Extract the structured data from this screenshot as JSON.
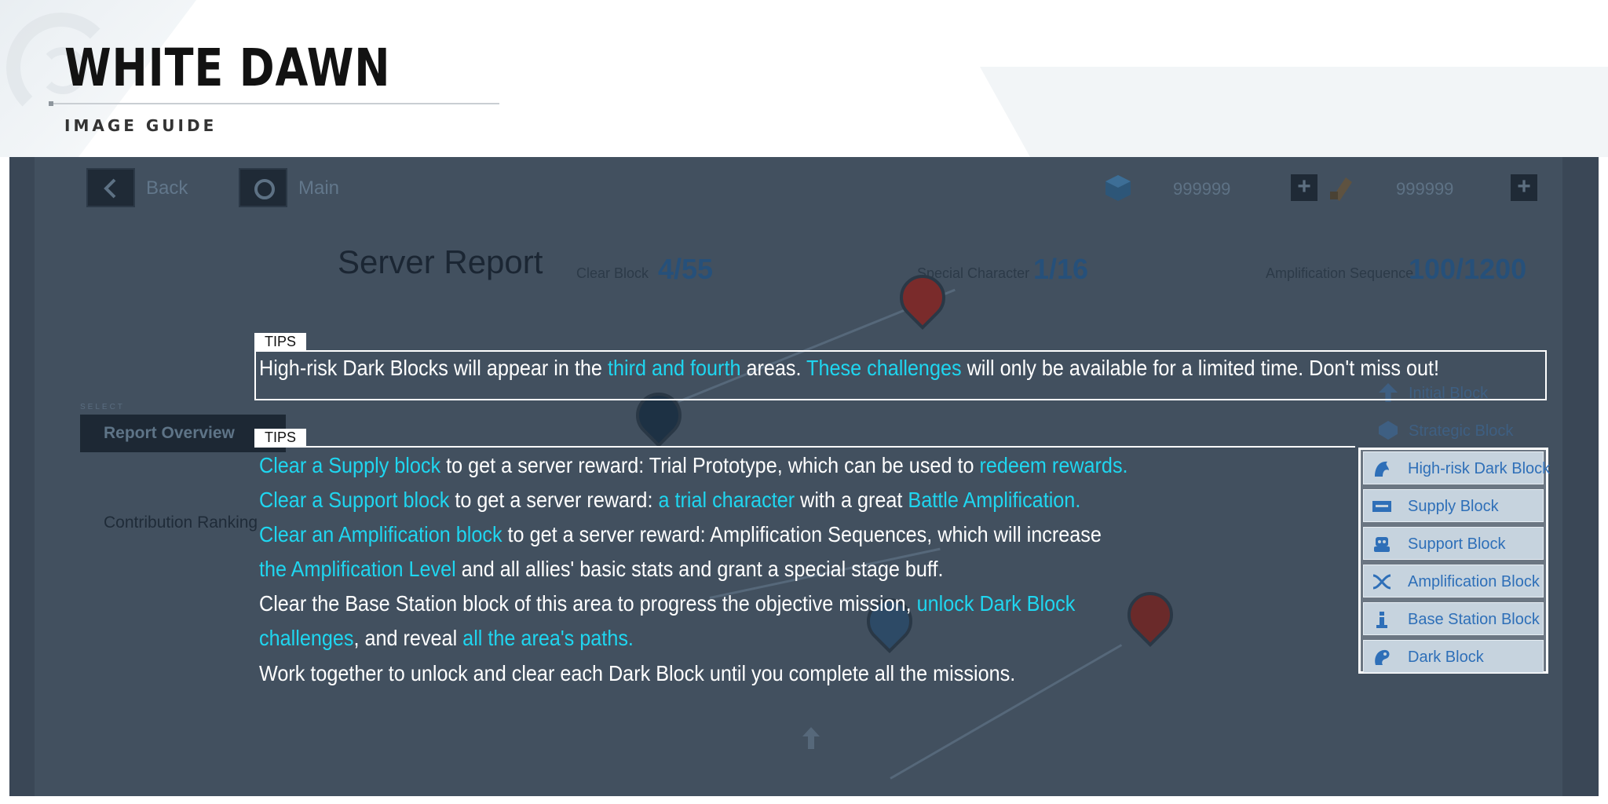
{
  "header": {
    "title": "WHITE DAWN",
    "subtitle": "IMAGE GUIDE"
  },
  "game": {
    "nav": {
      "back_label": "Back",
      "main_label": "Main"
    },
    "resources": [
      {
        "icon": "cube-icon",
        "value": "999999"
      },
      {
        "icon": "ticket-icon",
        "value": "999999"
      }
    ],
    "page_title": "Server Report",
    "stats": [
      {
        "label": "Clear Block",
        "value": "4/55"
      },
      {
        "label": "Special Character",
        "value": "1/16"
      },
      {
        "label": "Amplification Sequence",
        "value": "100/1200"
      }
    ],
    "sidebar": {
      "select_label": "SELECT",
      "items": [
        {
          "label": "Report Overview",
          "active": true
        },
        {
          "label": "Contribution Ranking",
          "active": false
        }
      ]
    },
    "legend_dim": [
      {
        "label": "Initial Block",
        "icon": "arrow-up-icon"
      },
      {
        "label": "Strategic Block",
        "icon": "layers-icon"
      }
    ],
    "legend": [
      {
        "label": "High-risk Dark Block",
        "icon": "dragon-icon"
      },
      {
        "label": "Supply Block",
        "icon": "supply-crate-icon"
      },
      {
        "label": "Support Block",
        "icon": "support-bot-icon"
      },
      {
        "label": "Amplification Block",
        "icon": "dna-icon"
      },
      {
        "label": "Base Station Block",
        "icon": "tower-icon"
      },
      {
        "label": "Dark Block",
        "icon": "dark-dragon-icon"
      }
    ]
  },
  "tips": {
    "label": "TIPS",
    "tip1": {
      "a": "High-risk Dark Blocks will appear in the ",
      "b": "third and fourth",
      "c": " areas. ",
      "d": "These challenges",
      "e": " will only be available for a limited time. Don't miss out!"
    },
    "tip2": {
      "line1": {
        "a": "Clear a Supply block",
        "b": " to get a server reward: Trial Prototype, which can be used to ",
        "c": "redeem rewards."
      },
      "line2": {
        "a": "Clear a Support block",
        "b": " to get a server reward: ",
        "c": "a trial character",
        "d": " with a great ",
        "e": "Battle Amplification."
      },
      "line3": {
        "a": "Clear an Amplification block",
        "b": " to get a server reward: Amplification Sequences, which will increase"
      },
      "line4": {
        "a": "the Amplification Level",
        "b": " and all allies' basic stats and grant a special stage buff."
      },
      "line5": {
        "a": "Clear the Base Station block of this area to progress the objective mission, ",
        "b": "unlock Dark Block"
      },
      "line6": {
        "a": "challenges",
        "b": ", and reveal ",
        "c": "all the area's paths."
      },
      "line7": {
        "a": "Work together to unlock and clear each Dark Block until you complete all the missions."
      }
    }
  },
  "colors": {
    "highlight": "#1fd6f0",
    "panel_bg": "#3a4756",
    "legend_text": "#2e6fb8"
  }
}
